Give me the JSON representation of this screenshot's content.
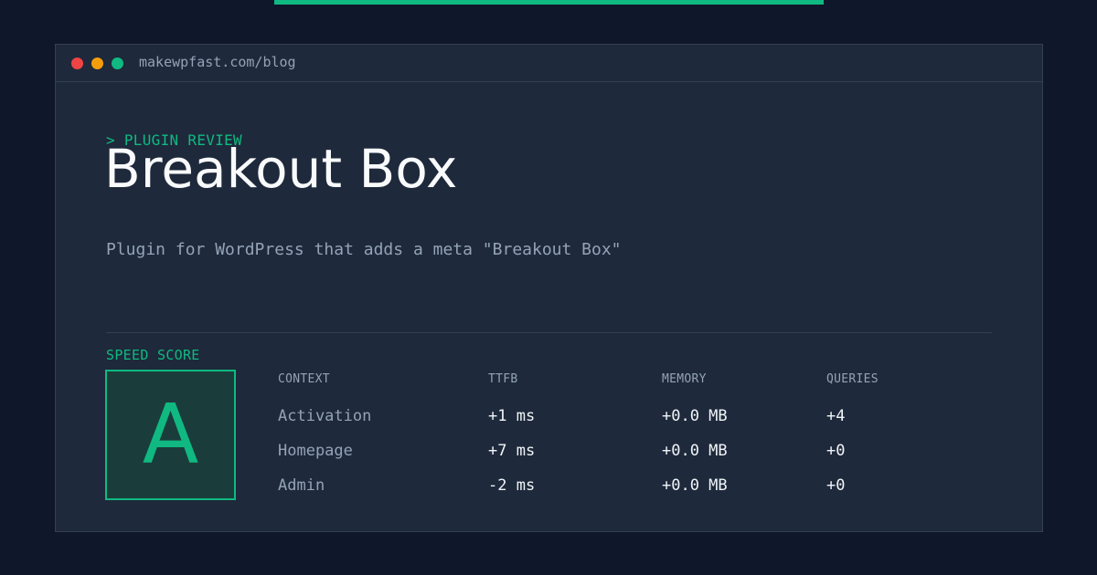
{
  "colors": {
    "page_background": "#0f172a",
    "window_background": "#1e293b",
    "accent": "#10b981",
    "dot_close": "#ef4444",
    "dot_minimize": "#f59e0b",
    "dot_maximize": "#10b981"
  },
  "browser": {
    "url": "makewpfast.com/blog"
  },
  "hero": {
    "kicker": "> PLUGIN REVIEW",
    "title": "Breakout Box",
    "description": "Plugin for WordPress that adds a meta \"Breakout Box\""
  },
  "speed": {
    "label": "SPEED SCORE",
    "grade": "A"
  },
  "table": {
    "headers": [
      "CONTEXT",
      "TTFB",
      "MEMORY",
      "QUERIES"
    ],
    "rows": [
      [
        "Activation",
        "+1 ms",
        "+0.0 MB",
        "+4"
      ],
      [
        "Homepage",
        "+7 ms",
        "+0.0 MB",
        "+0"
      ],
      [
        "Admin",
        "-2 ms",
        "+0.0 MB",
        "+0"
      ]
    ]
  }
}
